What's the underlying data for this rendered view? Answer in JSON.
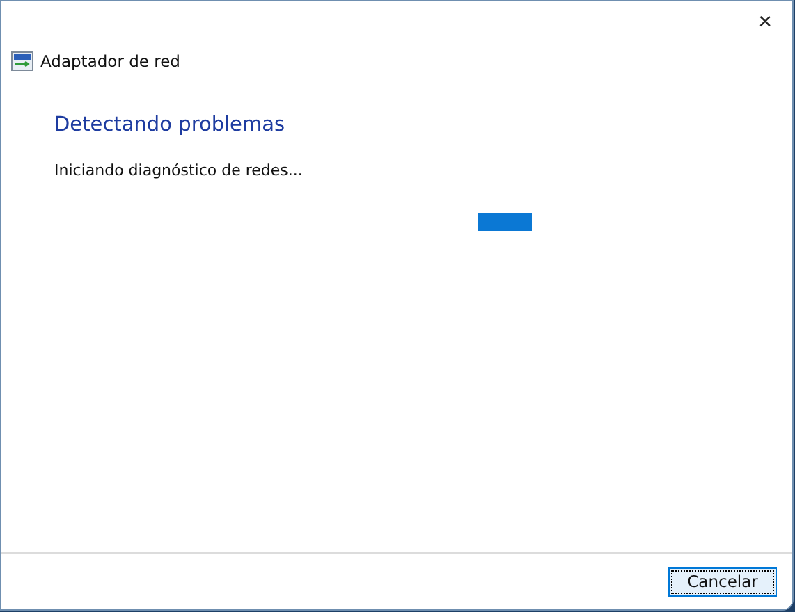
{
  "window": {
    "title": "Adaptador de red",
    "close": "✕"
  },
  "heading": "Detectando problemas",
  "status": "Iniciando diagnóstico de redes...",
  "buttons": [
    {
      "label": "Cancelar",
      "focused": true
    }
  ]
}
